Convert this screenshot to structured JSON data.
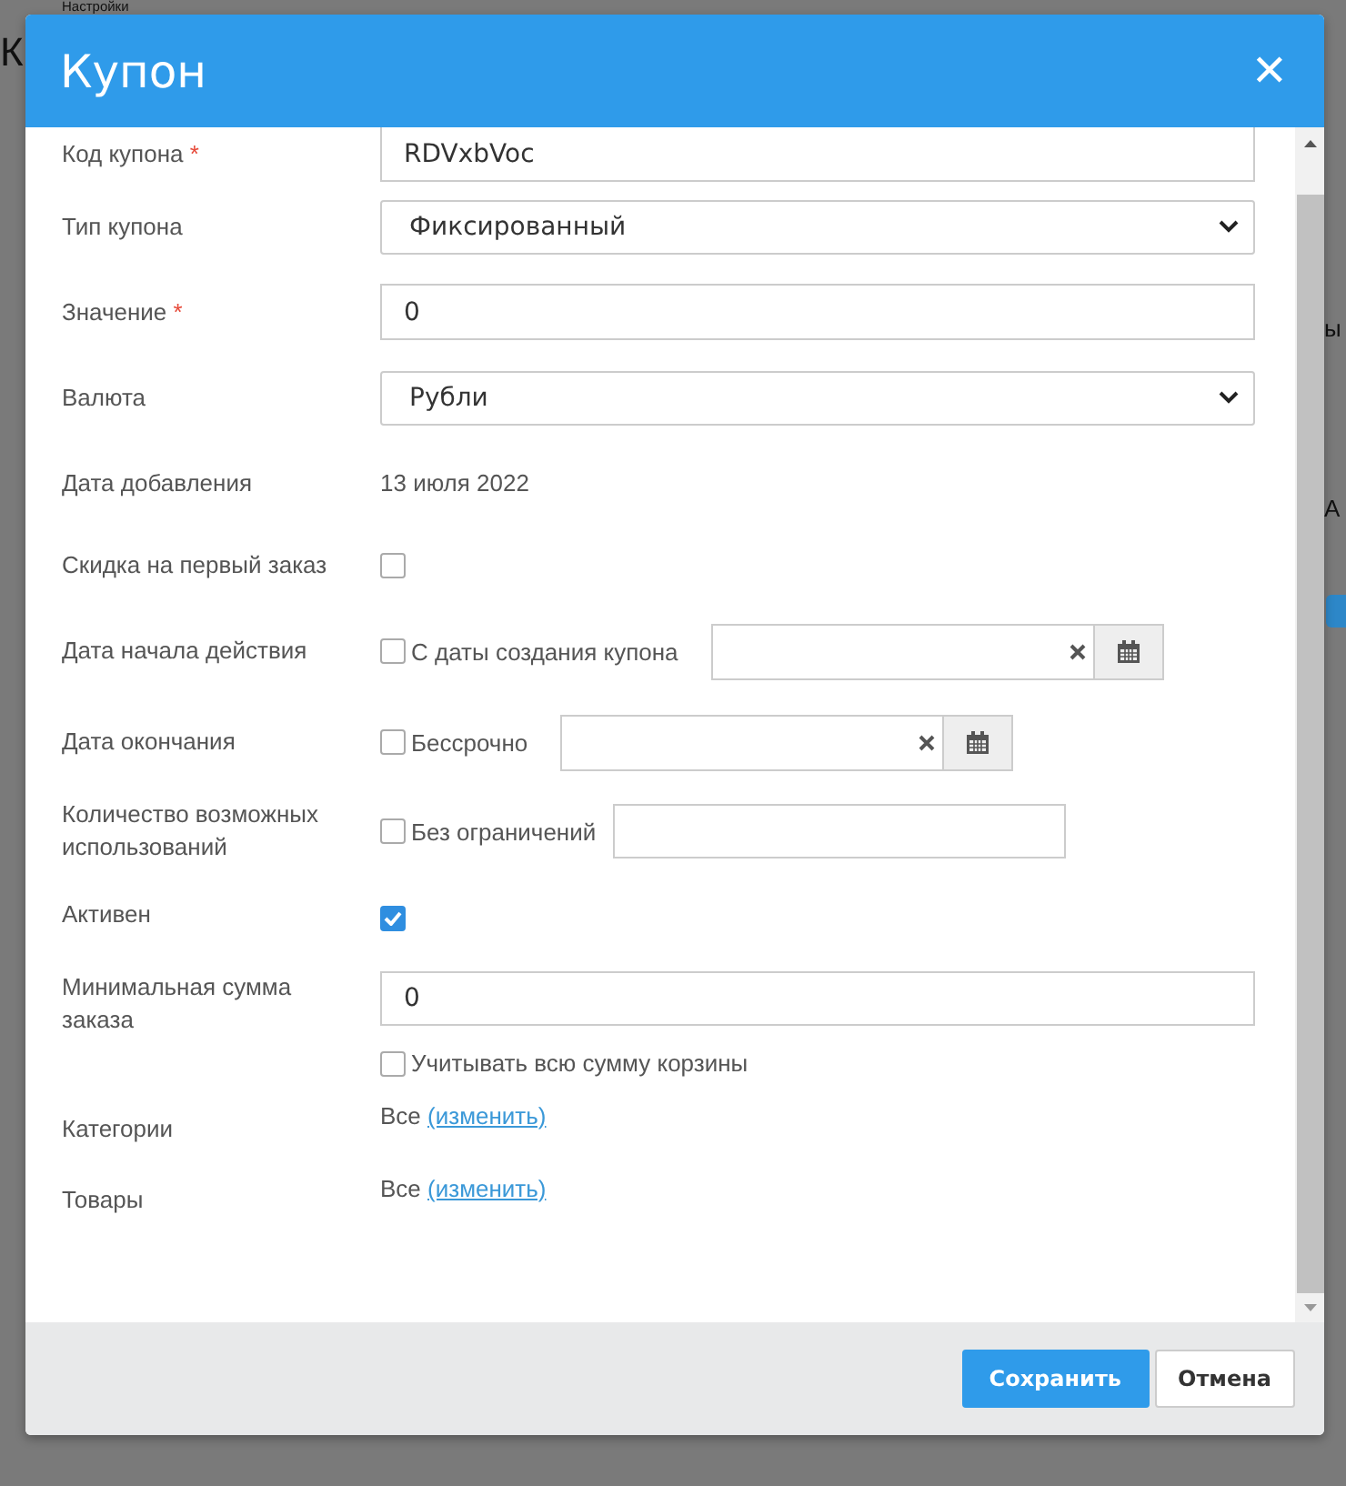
{
  "background": {
    "breadcrumb": "Настройки",
    "heading": "К",
    "fragments": [
      "ы",
      "А"
    ]
  },
  "dialog": {
    "title": "Купон",
    "close": "✕"
  },
  "fields": [
    {
      "kind": "text",
      "label": "Код купона",
      "required_mark": "*",
      "value": "RDVxbVoc"
    },
    {
      "kind": "select",
      "label": "Тип купона",
      "value": "Фиксированный"
    },
    {
      "kind": "text",
      "label": "Значение",
      "required_mark": "*",
      "value": "0"
    },
    {
      "kind": "select",
      "label": "Валюта",
      "value": "Рубли"
    },
    {
      "kind": "static",
      "label": "Дата добавления",
      "value": "13 июля 2022"
    },
    {
      "kind": "checkbox",
      "label": "Скидка на первый заказ",
      "checked": false
    },
    {
      "kind": "date",
      "label": "Дата начала действия",
      "checked": false,
      "option": "С даты создания купона"
    },
    {
      "kind": "date",
      "label": "Дата окончания",
      "checked": false,
      "option": "Бессрочно"
    },
    {
      "kind": "count",
      "label": "Количество возможных использований",
      "checked": false,
      "option": "Без ограничений"
    },
    {
      "kind": "checkbox",
      "label": "Активен",
      "checked": true
    },
    {
      "kind": "money",
      "label": "Минимальная сумма заказа",
      "value": "0",
      "checked": false,
      "option": "Учитывать всю сумму корзины"
    },
    {
      "kind": "link",
      "label": "Категории",
      "value": "Все",
      "link": "(изменить)"
    },
    {
      "kind": "link",
      "label": "Товары",
      "value": "Все",
      "link": "(изменить)"
    }
  ],
  "buttons": [
    {
      "label": "Сохранить",
      "primary": true
    },
    {
      "label": "Отмена",
      "primary": false
    }
  ]
}
